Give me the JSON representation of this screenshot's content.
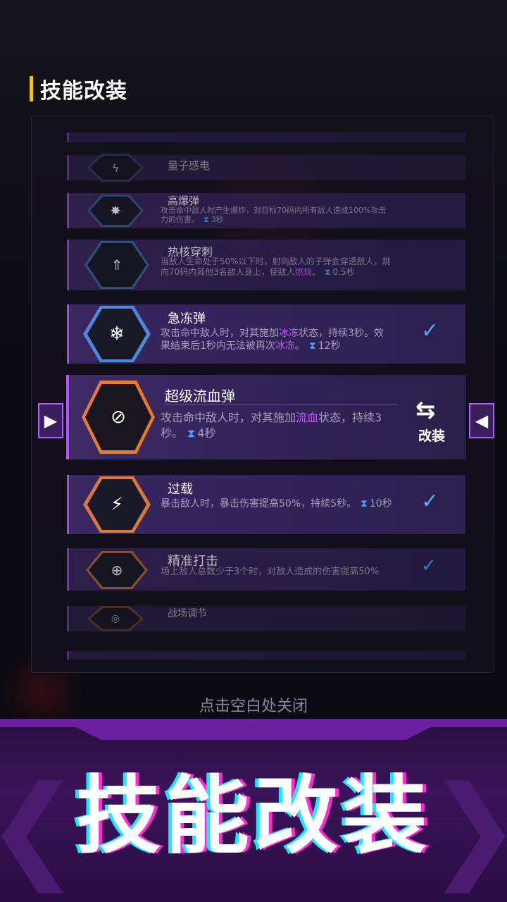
{
  "header": {
    "title": "技能改装"
  },
  "skills": [
    {
      "name": "量子感电",
      "desc": "",
      "cooldown": "",
      "equipped": false
    },
    {
      "name": "高爆弹",
      "desc": "攻击命中敌人时产生爆炸，对目标70码内所有敌人造成100%攻击力的伤害。",
      "cooldown": "3秒",
      "equipped": false
    },
    {
      "name": "热核穿刺",
      "desc_before": "当敌人生命处于50%以下时，射向敌人的子弹会穿透敌人，跳向70码内其他3名敌人身上，使敌人",
      "desc_hl": "燃烧",
      "desc_after": "。",
      "cooldown": "0.5秒",
      "equipped": false
    },
    {
      "name": "急冻弹",
      "desc_before": "攻击命中敌人时，对其施加",
      "desc_hl": "冰冻",
      "desc_after": "状态，持续3秒。效果结束后1秒内无法被再次",
      "desc_hl2": "冰冻",
      "desc_after2": "。",
      "cooldown": "12秒",
      "equipped": true
    },
    {
      "name": "超级流血弹",
      "desc_before": "攻击命中敌人时，对其施加",
      "desc_hl": "流血",
      "desc_after": "状态，持续3秒。",
      "cooldown": "4秒",
      "selected": true,
      "action_label": "改装"
    },
    {
      "name": "过载",
      "desc": "暴击敌人时，暴击伤害提高50%，持续5秒。",
      "cooldown": "10秒",
      "equipped": true
    },
    {
      "name": "精准打击",
      "desc": "场上敌人总数少于3个时，对敌人造成的伤害提高50%",
      "cooldown": "",
      "equipped": true
    },
    {
      "name": "战场调节",
      "desc": "",
      "cooldown": "",
      "equipped": false
    }
  ],
  "close_hint": "点击空白处关闭",
  "banner": {
    "text": "技能改装"
  },
  "icons": {
    "nav_left": "triangle-right-icon",
    "nav_right": "triangle-left-icon",
    "equipped": "checkmark-icon",
    "cooldown": "hourglass-icon",
    "swap": "swap-arrows-icon"
  },
  "colors": {
    "accent": "#f2c21a",
    "highlight": "#c65cff",
    "check": "#58a8e8",
    "selected_border": "#b256ff"
  }
}
